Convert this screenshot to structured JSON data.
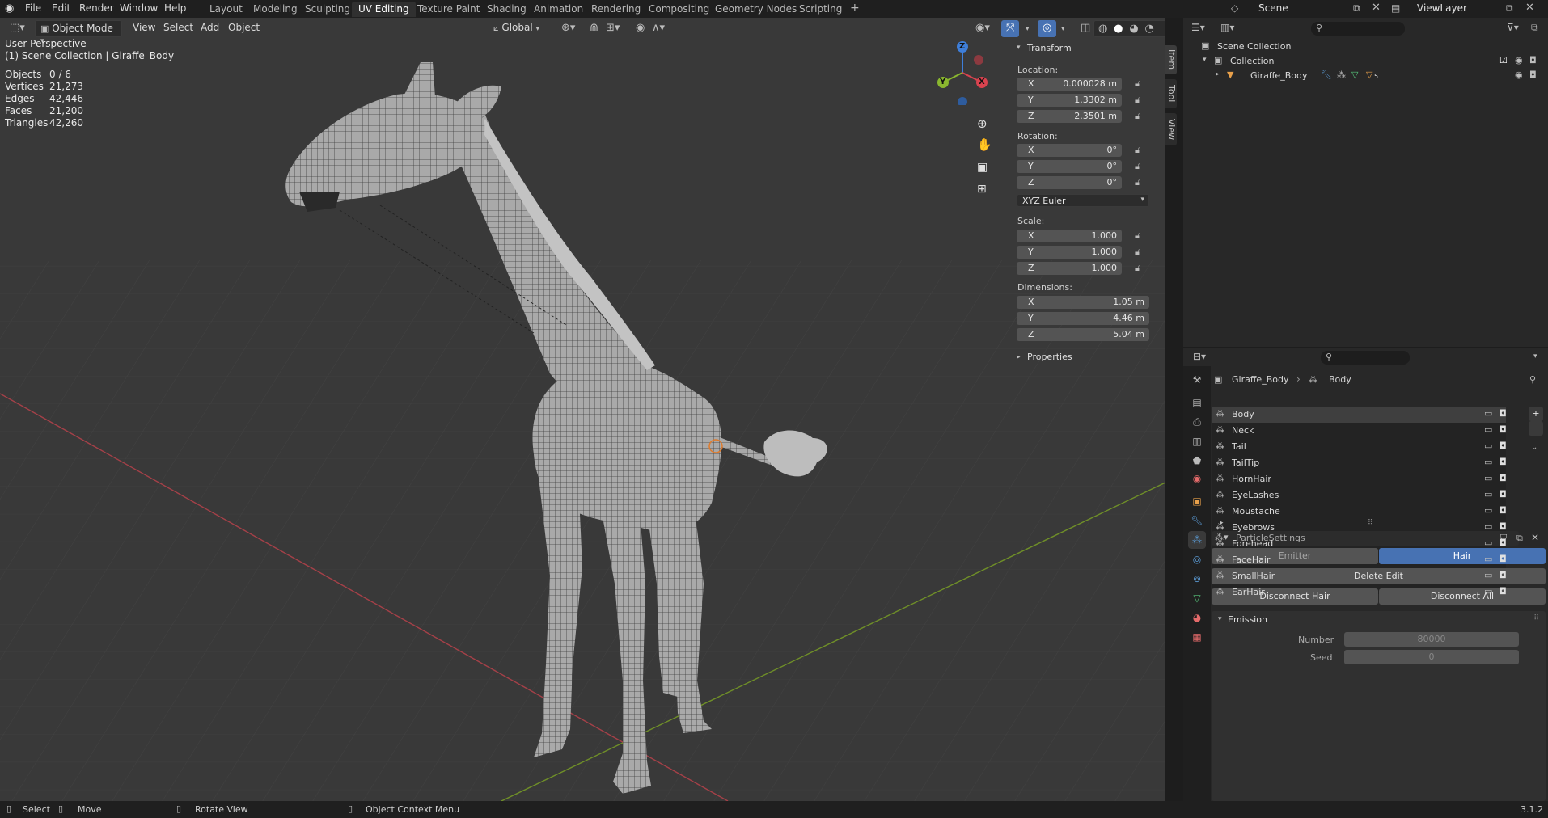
{
  "menu": [
    "File",
    "Edit",
    "Render",
    "Window",
    "Help"
  ],
  "workspaces": [
    "Layout",
    "Modeling",
    "Sculpting",
    "UV Editing",
    "Texture Paint",
    "Shading",
    "Animation",
    "Rendering",
    "Compositing",
    "Geometry Nodes",
    "Scripting"
  ],
  "active_workspace": "UV Editing",
  "add_workspace": "+",
  "scene_name": "Scene",
  "view_layer": "ViewLayer",
  "viewport": {
    "mode": "Object Mode",
    "menus": [
      "View",
      "Select",
      "Add",
      "Object"
    ],
    "transform_orientation": "Global",
    "perspective_label": "User Perspective",
    "collection_label": "(1) Scene Collection | Giraffe_Body",
    "stats": [
      {
        "label": "Objects",
        "value": "0 / 6"
      },
      {
        "label": "Vertices",
        "value": "21,273"
      },
      {
        "label": "Edges",
        "value": "42,446"
      },
      {
        "label": "Faces",
        "value": "21,200"
      },
      {
        "label": "Triangles",
        "value": "42,260"
      }
    ],
    "gizmo": {
      "x": "X",
      "y": "Y",
      "z": "Z"
    }
  },
  "npanel": {
    "tabs": [
      "Item",
      "Tool",
      "View"
    ],
    "section": "Transform",
    "location_label": "Location:",
    "location": [
      {
        "axis": "X",
        "value": "0.000028 m"
      },
      {
        "axis": "Y",
        "value": "1.3302 m"
      },
      {
        "axis": "Z",
        "value": "2.3501 m"
      }
    ],
    "rotation_label": "Rotation:",
    "rotation": [
      {
        "axis": "X",
        "value": "0°"
      },
      {
        "axis": "Y",
        "value": "0°"
      },
      {
        "axis": "Z",
        "value": "0°"
      }
    ],
    "rotation_mode": "XYZ Euler",
    "scale_label": "Scale:",
    "scale": [
      {
        "axis": "X",
        "value": "1.000"
      },
      {
        "axis": "Y",
        "value": "1.000"
      },
      {
        "axis": "Z",
        "value": "1.000"
      }
    ],
    "dimensions_label": "Dimensions:",
    "dimensions": [
      {
        "axis": "X",
        "value": "1.05 m"
      },
      {
        "axis": "Y",
        "value": "4.46 m"
      },
      {
        "axis": "Z",
        "value": "5.04 m"
      }
    ],
    "properties_section": "Properties"
  },
  "outliner": {
    "rows": [
      {
        "label": "Scene Collection",
        "indent": 0
      },
      {
        "label": "Collection",
        "indent": 1
      },
      {
        "label": "Giraffe_Body",
        "indent": 2
      }
    ],
    "modifier_count": "5"
  },
  "properties": {
    "breadcrumb_object": "Giraffe_Body",
    "breadcrumb_sep": "›",
    "breadcrumb_system": "Body",
    "particle_systems": [
      "Body",
      "Neck",
      "Tail",
      "TailTip",
      "HornHair",
      "EyeLashes",
      "Moustache",
      "Eyebrows",
      "Forehead",
      "FaceHair",
      "SmallHair",
      "EarHair"
    ],
    "selected_system": "Body",
    "settings_name": "ParticleSettings",
    "type_options": [
      "Emitter",
      "Hair"
    ],
    "active_type": "Hair",
    "delete_edit": "Delete Edit",
    "disconnect_hair": "Disconnect Hair",
    "disconnect_all": "Disconnect All",
    "emission_section": "Emission",
    "number_label": "Number",
    "number_value": "80000",
    "seed_label": "Seed",
    "seed_value": "0"
  },
  "statusbar": {
    "items": [
      "Select",
      "Move",
      "Rotate View",
      "Object Context Menu"
    ],
    "version": "3.1.2"
  },
  "colors": {
    "accent": "#4772b3",
    "viewport_bg": "#393939",
    "panel_bg": "#282828",
    "x_axis": "#d9434f",
    "y_axis": "#8ab72f",
    "z_axis": "#3e7ed9"
  }
}
